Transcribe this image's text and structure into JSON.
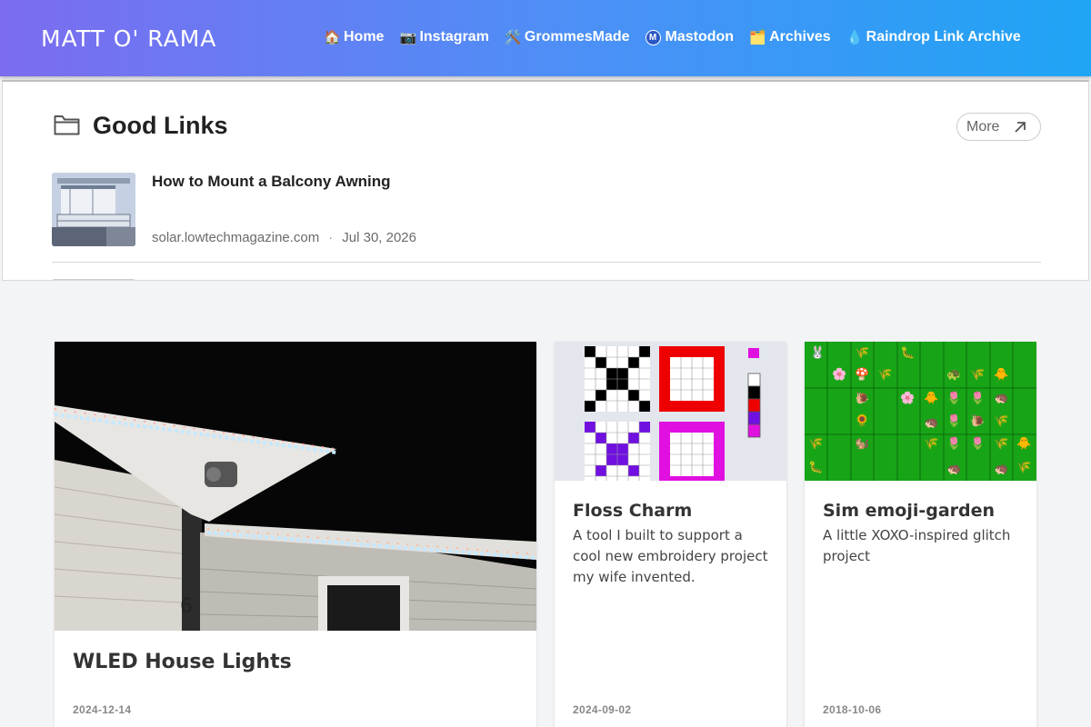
{
  "header": {
    "brand": "MATT O' RAMA",
    "nav": [
      {
        "icon": "🏠",
        "label": "Home"
      },
      {
        "icon": "📷",
        "label": "Instagram"
      },
      {
        "icon": "🛠️",
        "label": "GrommesMade"
      },
      {
        "icon": "M",
        "label": "Mastodon"
      },
      {
        "icon": "🗂️",
        "label": "Archives"
      },
      {
        "icon": "💧",
        "label": "Raindrop Link Archive"
      }
    ]
  },
  "links_panel": {
    "title": "Good Links",
    "more_label": "More",
    "items": [
      {
        "title": "How to Mount a Balcony Awning",
        "domain": "solar.lowtechmagazine.com",
        "separator": "·",
        "date": "Jul 30, 2026"
      }
    ]
  },
  "cards": [
    {
      "title": "WLED House Lights",
      "description": "",
      "date": "2024-12-14"
    },
    {
      "title": "Floss Charm",
      "description": "A tool I built to support a cool new embroidery project my wife invented.",
      "date": "2024-09-02"
    },
    {
      "title": "Sim emoji-garden",
      "description": "A little XOXO-inspired glitch project",
      "date": "2018-10-06"
    }
  ],
  "colors": {
    "header_gradient_start": "#7c6cf0",
    "header_gradient_end": "#1fa5f5",
    "page_background": "#f3f4f6",
    "garden_green": "#17a517"
  }
}
